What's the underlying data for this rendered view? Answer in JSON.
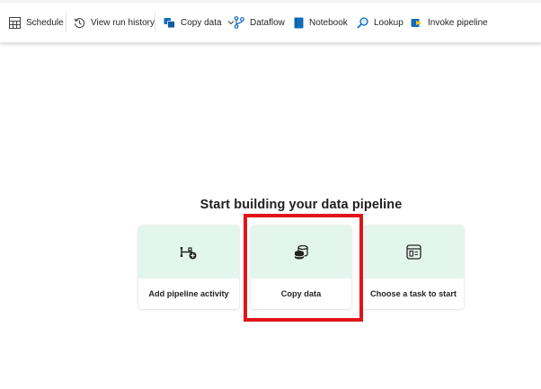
{
  "toolbar": {
    "items": [
      {
        "label": "Schedule",
        "icon": "calendar-table-icon"
      },
      {
        "label": "View run history",
        "icon": "history-icon"
      },
      {
        "label": "Copy data",
        "icon": "copy-data-icon",
        "has_dropdown": true
      },
      {
        "label": "Dataflow",
        "icon": "dataflow-icon"
      },
      {
        "label": "Notebook",
        "icon": "notebook-icon"
      },
      {
        "label": "Lookup",
        "icon": "lookup-icon"
      },
      {
        "label": "Invoke pipeline",
        "icon": "invoke-pipeline-icon"
      }
    ]
  },
  "main": {
    "heading": "Start building your data pipeline",
    "cards": [
      {
        "label": "Add pipeline activity",
        "icon": "pipeline-activity-add-icon"
      },
      {
        "label": "Copy data",
        "icon": "database-copy-icon",
        "highlighted": true
      },
      {
        "label": "Choose a task to start",
        "icon": "task-template-icon"
      }
    ]
  },
  "colors": {
    "card_header_bg": "#e3f6ee",
    "highlight_border": "#e2141a",
    "accent_blue": "#0f6cbd",
    "text": "#242424"
  }
}
